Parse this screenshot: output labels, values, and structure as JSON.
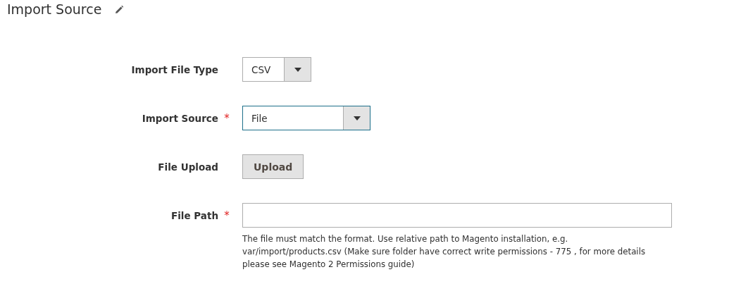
{
  "section": {
    "title": "Import Source"
  },
  "fields": [
    {
      "kind": "select",
      "label": "Import File Type",
      "value": "CSV",
      "focused": false
    },
    {
      "kind": "select",
      "label": "Import Source",
      "required_mark": "*",
      "value": "File",
      "focused": true
    },
    {
      "kind": "button",
      "label": "File Upload",
      "value": "Upload"
    },
    {
      "kind": "text",
      "label": "File Path",
      "required_mark": "*",
      "note": "The file must match the format. Use relative path to Magento installation, e.g. var/import/products.csv (Make sure folder have correct write permissions - 775 , for more details please see Magento 2 Permissions guide)"
    }
  ]
}
